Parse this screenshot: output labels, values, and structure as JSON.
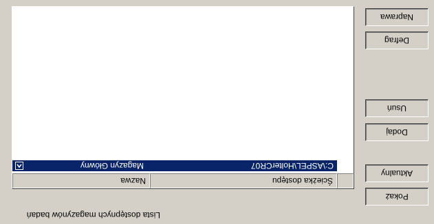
{
  "caption": "Lista dostępnych magazynów badań",
  "buttons": {
    "pokaz": "Pokaż",
    "aktualny": "Aktualny",
    "dodaj": "Dodaj",
    "usun": "Usuń",
    "defrag": "Defrag",
    "naprawa": "Naprawa"
  },
  "table": {
    "columns": [
      "Nazwa",
      "Ścieżka dostępu"
    ],
    "rows": [
      {
        "name": "Magazyn Główny",
        "path": "C:\\ASPEL\\HolterCR07",
        "selected": true
      }
    ]
  },
  "colors": {
    "selection": "#0a246a",
    "face": "#d4d0c8"
  }
}
